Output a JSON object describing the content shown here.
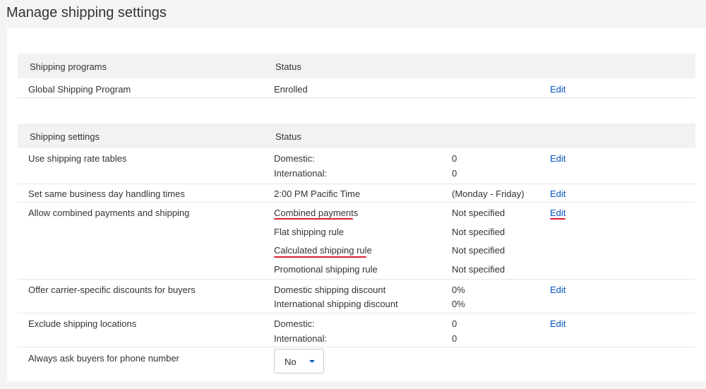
{
  "page_title": "Manage shipping settings",
  "programs": {
    "header_name": "Shipping programs",
    "header_status": "Status",
    "rows": [
      {
        "name": "Global Shipping Program",
        "status": "Enrolled",
        "edit": "Edit"
      }
    ]
  },
  "settings": {
    "header_name": "Shipping settings",
    "header_status": "Status",
    "rate_tables": {
      "name": "Use shipping rate tables",
      "domestic_label": "Domestic:",
      "domestic_value": "0",
      "international_label": "International:",
      "international_value": "0",
      "edit": "Edit"
    },
    "handling": {
      "name": "Set same business day handling times",
      "time": "2:00 PM Pacific Time",
      "days": "(Monday - Friday)",
      "edit": "Edit"
    },
    "combined": {
      "name": "Allow combined payments and shipping",
      "edit": "Edit",
      "items": [
        {
          "label": "Combined payments",
          "value": "Not specified"
        },
        {
          "label": "Flat shipping rule",
          "value": "Not specified"
        },
        {
          "label": "Calculated shipping rule",
          "value": "Not specified"
        },
        {
          "label": "Promotional shipping rule",
          "value": "Not specified"
        }
      ]
    },
    "discounts": {
      "name": "Offer carrier-specific discounts for buyers",
      "domestic_label": "Domestic shipping discount",
      "domestic_value": "0%",
      "international_label": "International shipping discount",
      "international_value": "0%",
      "edit": "Edit"
    },
    "exclude": {
      "name": "Exclude shipping locations",
      "domestic_label": "Domestic:",
      "domestic_value": "0",
      "international_label": "International:",
      "international_value": "0",
      "edit": "Edit"
    },
    "phone": {
      "name": "Always ask buyers for phone number",
      "selected": "No"
    }
  },
  "colors": {
    "link": "#0654ba",
    "highlight_underline": "#dd1e31",
    "header_bg": "#f2f2f2"
  }
}
